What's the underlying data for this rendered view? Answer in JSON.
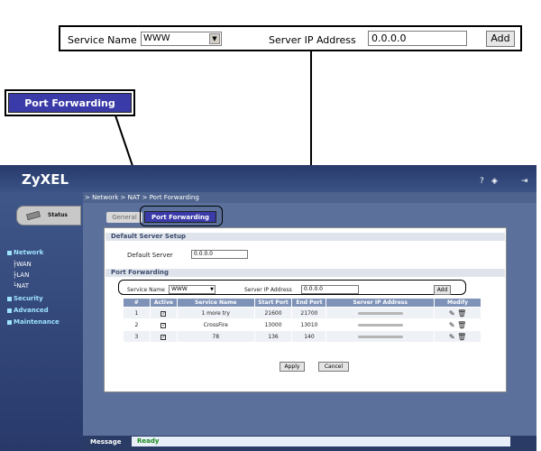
{
  "callout": {
    "service_name_label": "Service Name",
    "service_name_value": "WWW",
    "server_ip_label": "Server IP Address",
    "server_ip_value": "0.0.0.0",
    "add_label": "Add",
    "tab_label": "Port Forwarding"
  },
  "app": {
    "brand": "ZyXEL",
    "breadcrumb": "> Network > NAT > Port Forwarding",
    "status_tab": "Status",
    "nav": [
      {
        "label": "Network",
        "level": "top"
      },
      {
        "label": "WAN",
        "level": "sub"
      },
      {
        "label": "LAN",
        "level": "sub"
      },
      {
        "label": "NAT",
        "level": "sub"
      },
      {
        "label": "Security",
        "level": "top"
      },
      {
        "label": "Advanced",
        "level": "top"
      },
      {
        "label": "Maintenance",
        "level": "top"
      }
    ],
    "tabs": {
      "general": "General",
      "port_forwarding": "Port Forwarding"
    },
    "default_server": {
      "section_title": "Default Server Setup",
      "label": "Default Server",
      "value": "0.0.0.0"
    },
    "port_forwarding": {
      "section_title": "Port Forwarding",
      "service_name_label": "Service Name",
      "service_name_value": "WWW",
      "server_ip_label": "Server IP Address",
      "server_ip_value": "0.0.0.0",
      "add_label": "Add",
      "columns": [
        "#",
        "Active",
        "Service Name",
        "Start Port",
        "End Port",
        "Server IP Address",
        "Modify"
      ],
      "rows": [
        {
          "num": "1",
          "active": true,
          "service": "1 more try",
          "start": "21600",
          "end": "21700"
        },
        {
          "num": "2",
          "active": true,
          "service": "CrossFire",
          "start": "13000",
          "end": "13010"
        },
        {
          "num": "3",
          "active": true,
          "service": "78",
          "start": "136",
          "end": "140"
        }
      ]
    },
    "buttons": {
      "apply": "Apply",
      "cancel": "Cancel"
    },
    "message_label": "Message",
    "message_value": "Ready",
    "check_glyph": "✓",
    "icons": {
      "edit": "✎",
      "delete": "🗑"
    }
  }
}
